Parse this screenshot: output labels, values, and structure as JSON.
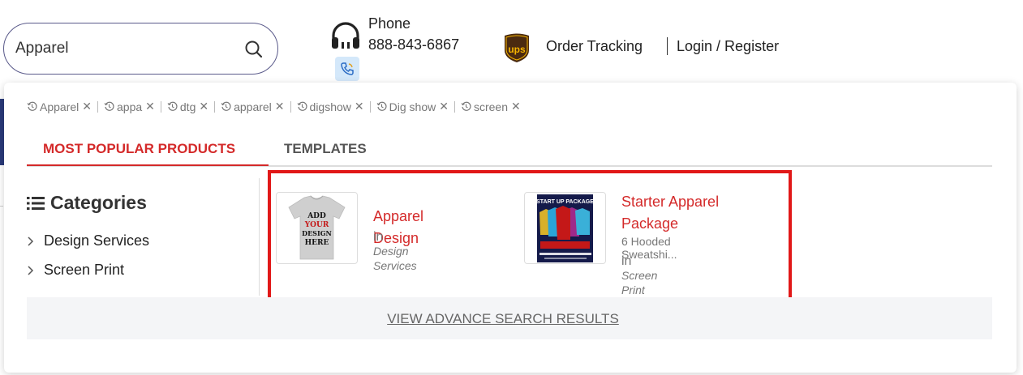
{
  "search": {
    "value": "Apparel",
    "icon": "search-icon"
  },
  "contact": {
    "label": "Phone",
    "number": "888-843-6867"
  },
  "header": {
    "order_tracking": "Order Tracking",
    "login": "Login / Register"
  },
  "history": [
    {
      "label": "Apparel"
    },
    {
      "label": "appa"
    },
    {
      "label": "dtg"
    },
    {
      "label": "apparel"
    },
    {
      "label": "digshow"
    },
    {
      "label": "Dig show"
    },
    {
      "label": "screen"
    }
  ],
  "tabs": {
    "popular": "MOST POPULAR PRODUCTS",
    "templates": "TEMPLATES"
  },
  "categories": {
    "title": "Categories",
    "items": [
      {
        "label": "Design Services"
      },
      {
        "label": "Screen Print"
      }
    ]
  },
  "products": [
    {
      "name": "Apparel Design",
      "in": "in",
      "category": "Design Services",
      "thumb_text": [
        "ADD",
        "YOUR",
        "DESIGN",
        "HERE"
      ]
    },
    {
      "name": "Starter Apparel Package",
      "subtitle": "6 Hooded Sweatshi...",
      "in": "in",
      "category": "Screen Print",
      "thumb_text": "START UP PACKAGE"
    }
  ],
  "advance_search": "VIEW ADVANCE SEARCH RESULTS",
  "colors": {
    "accent_red": "#d42a2a",
    "highlight_red": "#e11818",
    "border_navy": "#5a5a8a",
    "call_chip_bg": "#d4e8fa",
    "ups_brown": "#4a2a10",
    "ups_gold": "#f5b400"
  }
}
